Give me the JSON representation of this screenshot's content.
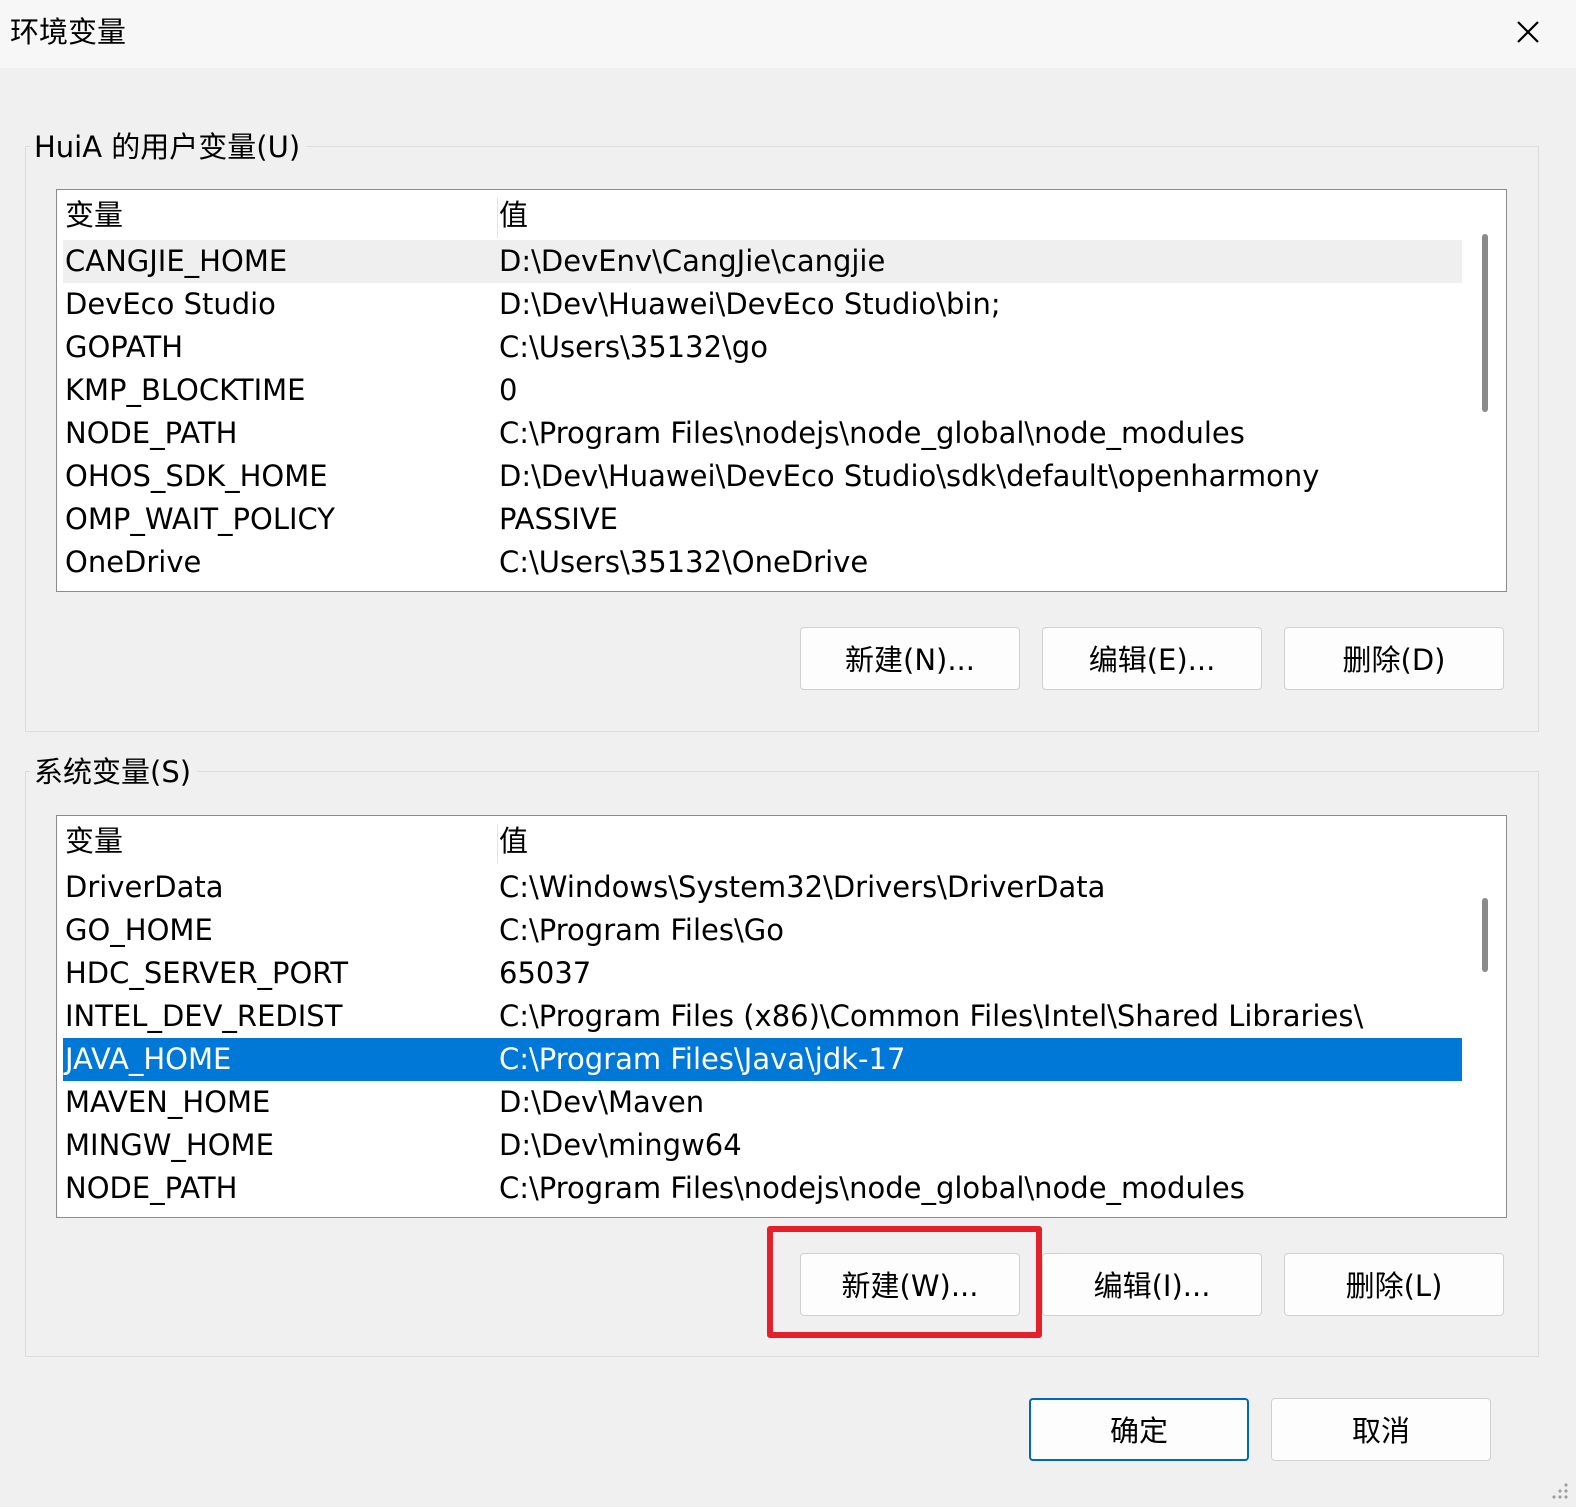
{
  "window": {
    "title": "环境变量",
    "close_icon": "close-icon"
  },
  "user_vars": {
    "label": "HuiA 的用户变量(U)",
    "header": {
      "name": "变量",
      "value": "值"
    },
    "rows": [
      {
        "name": "CANGJIE_HOME",
        "value": "D:\\DevEnv\\CangJie\\cangjie"
      },
      {
        "name": "DevEco Studio",
        "value": "D:\\Dev\\Huawei\\DevEco Studio\\bin;"
      },
      {
        "name": "GOPATH",
        "value": "C:\\Users\\35132\\go"
      },
      {
        "name": "KMP_BLOCKTIME",
        "value": "0"
      },
      {
        "name": "NODE_PATH",
        "value": "C:\\Program Files\\nodejs\\node_global\\node_modules"
      },
      {
        "name": "OHOS_SDK_HOME",
        "value": "D:\\Dev\\Huawei\\DevEco Studio\\sdk\\default\\openharmony"
      },
      {
        "name": "OMP_WAIT_POLICY",
        "value": "PASSIVE"
      },
      {
        "name": "OneDrive",
        "value": "C:\\Users\\35132\\OneDrive"
      }
    ],
    "buttons": {
      "new": "新建(N)...",
      "edit": "编辑(E)...",
      "delete": "删除(D)"
    }
  },
  "system_vars": {
    "label": "系统变量(S)",
    "header": {
      "name": "变量",
      "value": "值"
    },
    "rows": [
      {
        "name": "DriverData",
        "value": "C:\\Windows\\System32\\Drivers\\DriverData"
      },
      {
        "name": "GO_HOME",
        "value": "C:\\Program Files\\Go"
      },
      {
        "name": "HDC_SERVER_PORT",
        "value": "65037"
      },
      {
        "name": "INTEL_DEV_REDIST",
        "value": "C:\\Program Files (x86)\\Common Files\\Intel\\Shared Libraries\\"
      },
      {
        "name": "JAVA_HOME",
        "value": "C:\\Program Files\\Java\\jdk-17"
      },
      {
        "name": "MAVEN_HOME",
        "value": "D:\\Dev\\Maven"
      },
      {
        "name": "MINGW_HOME",
        "value": "D:\\Dev\\mingw64"
      },
      {
        "name": "NODE_PATH",
        "value": "C:\\Program Files\\nodejs\\node_global\\node_modules"
      }
    ],
    "selected_row": "JAVA_HOME",
    "buttons": {
      "new": "新建(W)...",
      "edit": "编辑(I)...",
      "delete": "删除(L)"
    }
  },
  "footer": {
    "ok": "确定",
    "cancel": "取消"
  },
  "colors": {
    "selection": "#0078d7",
    "highlight_box": "#e4202a",
    "default_button_border": "#0067c0"
  }
}
